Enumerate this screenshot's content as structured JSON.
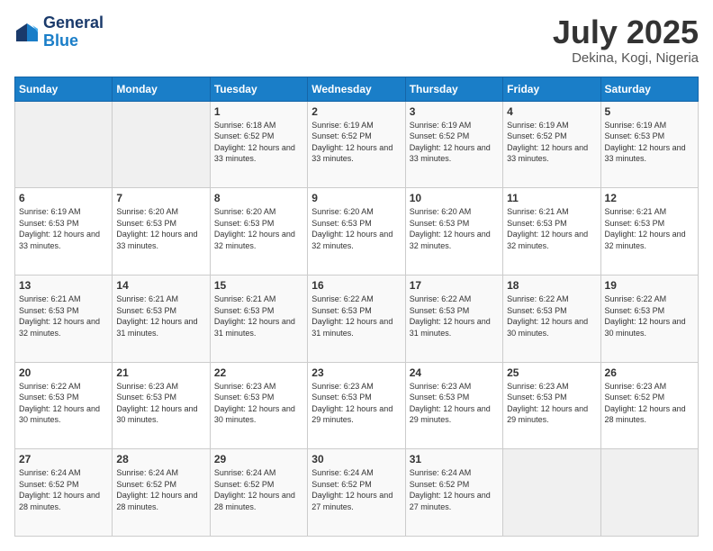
{
  "header": {
    "logo_line1": "General",
    "logo_line2": "Blue",
    "month": "July 2025",
    "location": "Dekina, Kogi, Nigeria"
  },
  "days_of_week": [
    "Sunday",
    "Monday",
    "Tuesday",
    "Wednesday",
    "Thursday",
    "Friday",
    "Saturday"
  ],
  "weeks": [
    [
      {
        "day": "",
        "info": ""
      },
      {
        "day": "",
        "info": ""
      },
      {
        "day": "1",
        "info": "Sunrise: 6:18 AM\nSunset: 6:52 PM\nDaylight: 12 hours and 33 minutes."
      },
      {
        "day": "2",
        "info": "Sunrise: 6:19 AM\nSunset: 6:52 PM\nDaylight: 12 hours and 33 minutes."
      },
      {
        "day": "3",
        "info": "Sunrise: 6:19 AM\nSunset: 6:52 PM\nDaylight: 12 hours and 33 minutes."
      },
      {
        "day": "4",
        "info": "Sunrise: 6:19 AM\nSunset: 6:52 PM\nDaylight: 12 hours and 33 minutes."
      },
      {
        "day": "5",
        "info": "Sunrise: 6:19 AM\nSunset: 6:53 PM\nDaylight: 12 hours and 33 minutes."
      }
    ],
    [
      {
        "day": "6",
        "info": "Sunrise: 6:19 AM\nSunset: 6:53 PM\nDaylight: 12 hours and 33 minutes."
      },
      {
        "day": "7",
        "info": "Sunrise: 6:20 AM\nSunset: 6:53 PM\nDaylight: 12 hours and 33 minutes."
      },
      {
        "day": "8",
        "info": "Sunrise: 6:20 AM\nSunset: 6:53 PM\nDaylight: 12 hours and 32 minutes."
      },
      {
        "day": "9",
        "info": "Sunrise: 6:20 AM\nSunset: 6:53 PM\nDaylight: 12 hours and 32 minutes."
      },
      {
        "day": "10",
        "info": "Sunrise: 6:20 AM\nSunset: 6:53 PM\nDaylight: 12 hours and 32 minutes."
      },
      {
        "day": "11",
        "info": "Sunrise: 6:21 AM\nSunset: 6:53 PM\nDaylight: 12 hours and 32 minutes."
      },
      {
        "day": "12",
        "info": "Sunrise: 6:21 AM\nSunset: 6:53 PM\nDaylight: 12 hours and 32 minutes."
      }
    ],
    [
      {
        "day": "13",
        "info": "Sunrise: 6:21 AM\nSunset: 6:53 PM\nDaylight: 12 hours and 32 minutes."
      },
      {
        "day": "14",
        "info": "Sunrise: 6:21 AM\nSunset: 6:53 PM\nDaylight: 12 hours and 31 minutes."
      },
      {
        "day": "15",
        "info": "Sunrise: 6:21 AM\nSunset: 6:53 PM\nDaylight: 12 hours and 31 minutes."
      },
      {
        "day": "16",
        "info": "Sunrise: 6:22 AM\nSunset: 6:53 PM\nDaylight: 12 hours and 31 minutes."
      },
      {
        "day": "17",
        "info": "Sunrise: 6:22 AM\nSunset: 6:53 PM\nDaylight: 12 hours and 31 minutes."
      },
      {
        "day": "18",
        "info": "Sunrise: 6:22 AM\nSunset: 6:53 PM\nDaylight: 12 hours and 30 minutes."
      },
      {
        "day": "19",
        "info": "Sunrise: 6:22 AM\nSunset: 6:53 PM\nDaylight: 12 hours and 30 minutes."
      }
    ],
    [
      {
        "day": "20",
        "info": "Sunrise: 6:22 AM\nSunset: 6:53 PM\nDaylight: 12 hours and 30 minutes."
      },
      {
        "day": "21",
        "info": "Sunrise: 6:23 AM\nSunset: 6:53 PM\nDaylight: 12 hours and 30 minutes."
      },
      {
        "day": "22",
        "info": "Sunrise: 6:23 AM\nSunset: 6:53 PM\nDaylight: 12 hours and 30 minutes."
      },
      {
        "day": "23",
        "info": "Sunrise: 6:23 AM\nSunset: 6:53 PM\nDaylight: 12 hours and 29 minutes."
      },
      {
        "day": "24",
        "info": "Sunrise: 6:23 AM\nSunset: 6:53 PM\nDaylight: 12 hours and 29 minutes."
      },
      {
        "day": "25",
        "info": "Sunrise: 6:23 AM\nSunset: 6:53 PM\nDaylight: 12 hours and 29 minutes."
      },
      {
        "day": "26",
        "info": "Sunrise: 6:23 AM\nSunset: 6:52 PM\nDaylight: 12 hours and 28 minutes."
      }
    ],
    [
      {
        "day": "27",
        "info": "Sunrise: 6:24 AM\nSunset: 6:52 PM\nDaylight: 12 hours and 28 minutes."
      },
      {
        "day": "28",
        "info": "Sunrise: 6:24 AM\nSunset: 6:52 PM\nDaylight: 12 hours and 28 minutes."
      },
      {
        "day": "29",
        "info": "Sunrise: 6:24 AM\nSunset: 6:52 PM\nDaylight: 12 hours and 28 minutes."
      },
      {
        "day": "30",
        "info": "Sunrise: 6:24 AM\nSunset: 6:52 PM\nDaylight: 12 hours and 27 minutes."
      },
      {
        "day": "31",
        "info": "Sunrise: 6:24 AM\nSunset: 6:52 PM\nDaylight: 12 hours and 27 minutes."
      },
      {
        "day": "",
        "info": ""
      },
      {
        "day": "",
        "info": ""
      }
    ]
  ]
}
